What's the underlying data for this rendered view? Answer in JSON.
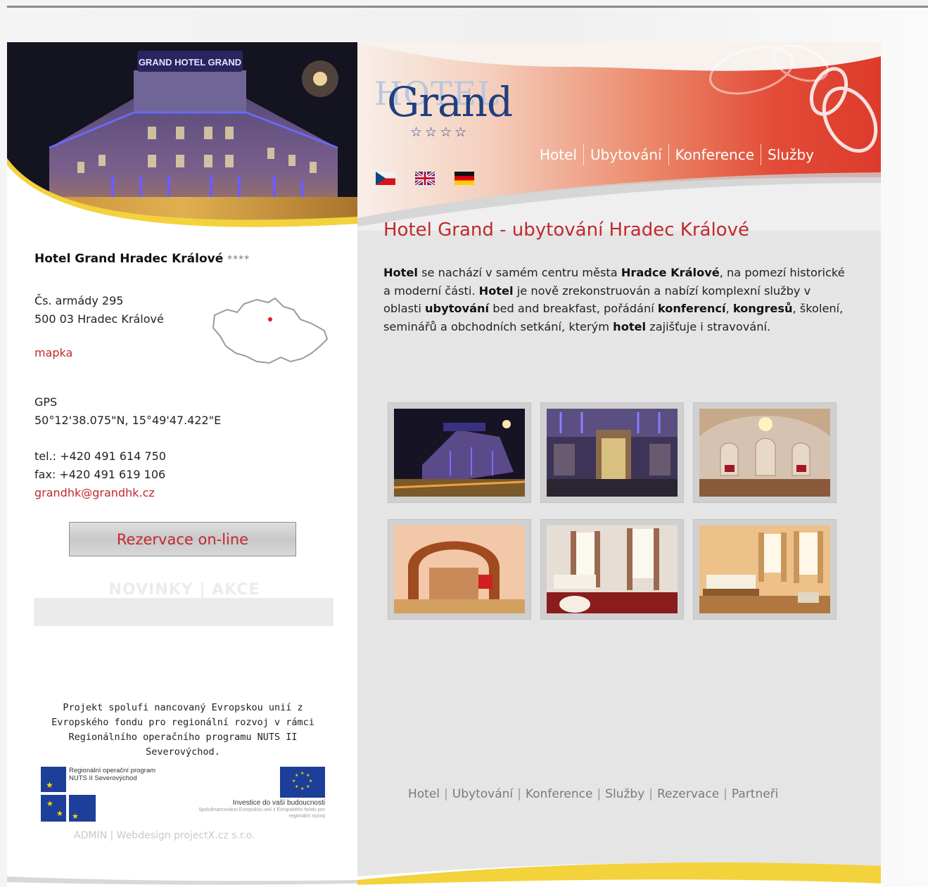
{
  "header": {
    "logo_ghost": "HOTEL",
    "logo_main": "Grand",
    "logo_stars": "☆☆☆☆",
    "nav": [
      {
        "label": "Hotel"
      },
      {
        "label": "Ubytování"
      },
      {
        "label": "Konference"
      },
      {
        "label": "Služby"
      }
    ],
    "languages": [
      "cs",
      "en",
      "de"
    ],
    "photo_sign": "GRAND  HOTEL  GRAND"
  },
  "sidebar": {
    "hotel_name": "Hotel Grand Hradec Králové",
    "hotel_stars": "****",
    "address_line1": "Čs. armády 295",
    "address_line2": "500 03 Hradec Králové",
    "map_link": "mapka",
    "gps_label": "GPS",
    "gps_value": "50°12'38.075\"N, 15°49'47.422\"E",
    "tel": "tel.: +420 491 614 750",
    "fax": "fax: +420 491 619 106",
    "email": "grandhk@grandhk.cz",
    "reserve_button": "Rezervace on-line",
    "news_title": "NOVINKY | AKCE",
    "eu_text": "Projekt spolufi nancovaný Evropskou unií z Evropského fondu pro regionální rozvoj v rámci Regionálního operačního programu NUTS II Severovýchod.",
    "eu_logo_left_text": "Regionální operační program NUTS II Severovýchod",
    "eu_logo_right_title": "Investice do vaší budoucnosti",
    "eu_logo_right_sub": "Spolufinancováno Evropskou unií z Evropského fondu pro regionální rozvoj",
    "footer_admin": "ADMIN",
    "footer_sep": "|",
    "footer_webdesign": "Webdesign projectX.cz s.r.o."
  },
  "main": {
    "title": "Hotel Grand - ubytování Hradec Králové",
    "intro": [
      {
        "b": "Hotel"
      },
      {
        "t": " se nachází v samém centru města "
      },
      {
        "b": "Hradce Králové"
      },
      {
        "t": ", na pomezí historické a moderní části. "
      },
      {
        "b": "Hotel"
      },
      {
        "t": " je nově zrekonstruován a nabízí komplexní služby v oblasti "
      },
      {
        "b": "ubytování"
      },
      {
        "t": " bed and breakfast, pořádání "
      },
      {
        "b": "konferencí"
      },
      {
        "t": ", "
      },
      {
        "b": "kongresů"
      },
      {
        "t": ", školení, seminářů a obchodních setkání, kterým "
      },
      {
        "b": "hotel"
      },
      {
        "t": " zajišťuje i stravování."
      }
    ],
    "gallery": [
      {
        "name": "photo-hotel-night"
      },
      {
        "name": "photo-hotel-entrance"
      },
      {
        "name": "photo-conference-hall"
      },
      {
        "name": "photo-lobby-arch"
      },
      {
        "name": "photo-room-red"
      },
      {
        "name": "photo-room-orange"
      }
    ]
  },
  "footer": {
    "links": [
      "Hotel",
      "Ubytování",
      "Konference",
      "Služby",
      "Rezervace",
      "Partneři"
    ],
    "separator": "|"
  },
  "colors": {
    "accent_red": "#c1292e",
    "logo_blue": "#1f3f7e",
    "header_red": "#dd3b2c",
    "panel_grey": "#e5e5e5",
    "swoosh_yellow": "#f3d23c"
  }
}
